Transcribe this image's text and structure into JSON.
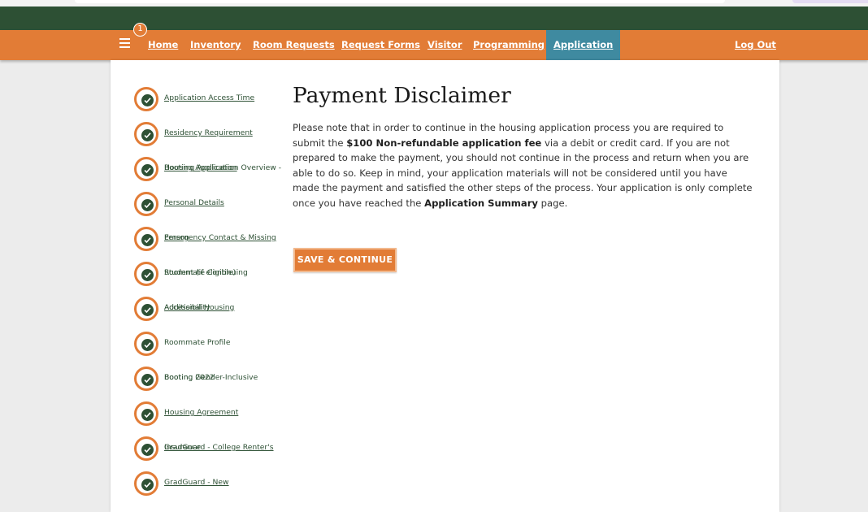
{
  "header": {
    "notification_count": "1",
    "menu_icon": "hamburger-menu-icon",
    "nav": [
      "Home",
      "Inventory",
      "Room Requests",
      "Request Forms",
      "Visitor",
      "Programming",
      "Application"
    ],
    "active_nav": "Application",
    "logout": "Log Out"
  },
  "sidebar": {
    "icon": "check-icon",
    "steps": [
      {
        "label": "Application Access Time"
      },
      {
        "label": "Residency Requirement"
      },
      {
        "label": "Booting Application",
        "overlay": "Housing Application Overview -"
      },
      {
        "label": "Personal Details"
      },
      {
        "label": "Emergency Contact & Missing",
        "overlay": "Person"
      },
      {
        "label": "Student (if eligible)",
        "overlay": "Roommate Continuing"
      },
      {
        "label": "Additional Housing",
        "overlay": "Accessibility"
      },
      {
        "label": "Roommate Profile"
      },
      {
        "label": "Booting Gender-Inclusive",
        "overlay": "Booting 2022"
      },
      {
        "label": "Housing Agreement"
      },
      {
        "label": "GradGuard - College Renter's",
        "overlay": "Insurance"
      },
      {
        "label": "GradGuard - New"
      }
    ]
  },
  "main": {
    "title": "Payment Disclaimer",
    "p1": "Please note that in order to continue in the housing application process you are required to submit the ",
    "fee": "$100 Non-refundable application fee",
    "p2": " via a debit or credit card. If you are not prepared to make the payment, you should not continue in the process and return when you are able to do so. Keep in mind, your application materials will not be considered until you have made the payment and satisfied the other steps of the process. Your application is only complete once you have reached the ",
    "summary": "Application Summary",
    "p3": " page.",
    "save_button": "SAVE & CONTINUE"
  },
  "colors": {
    "green": "#2d5034",
    "orange": "#e27c36",
    "active_tab": "#3f8aa0"
  }
}
